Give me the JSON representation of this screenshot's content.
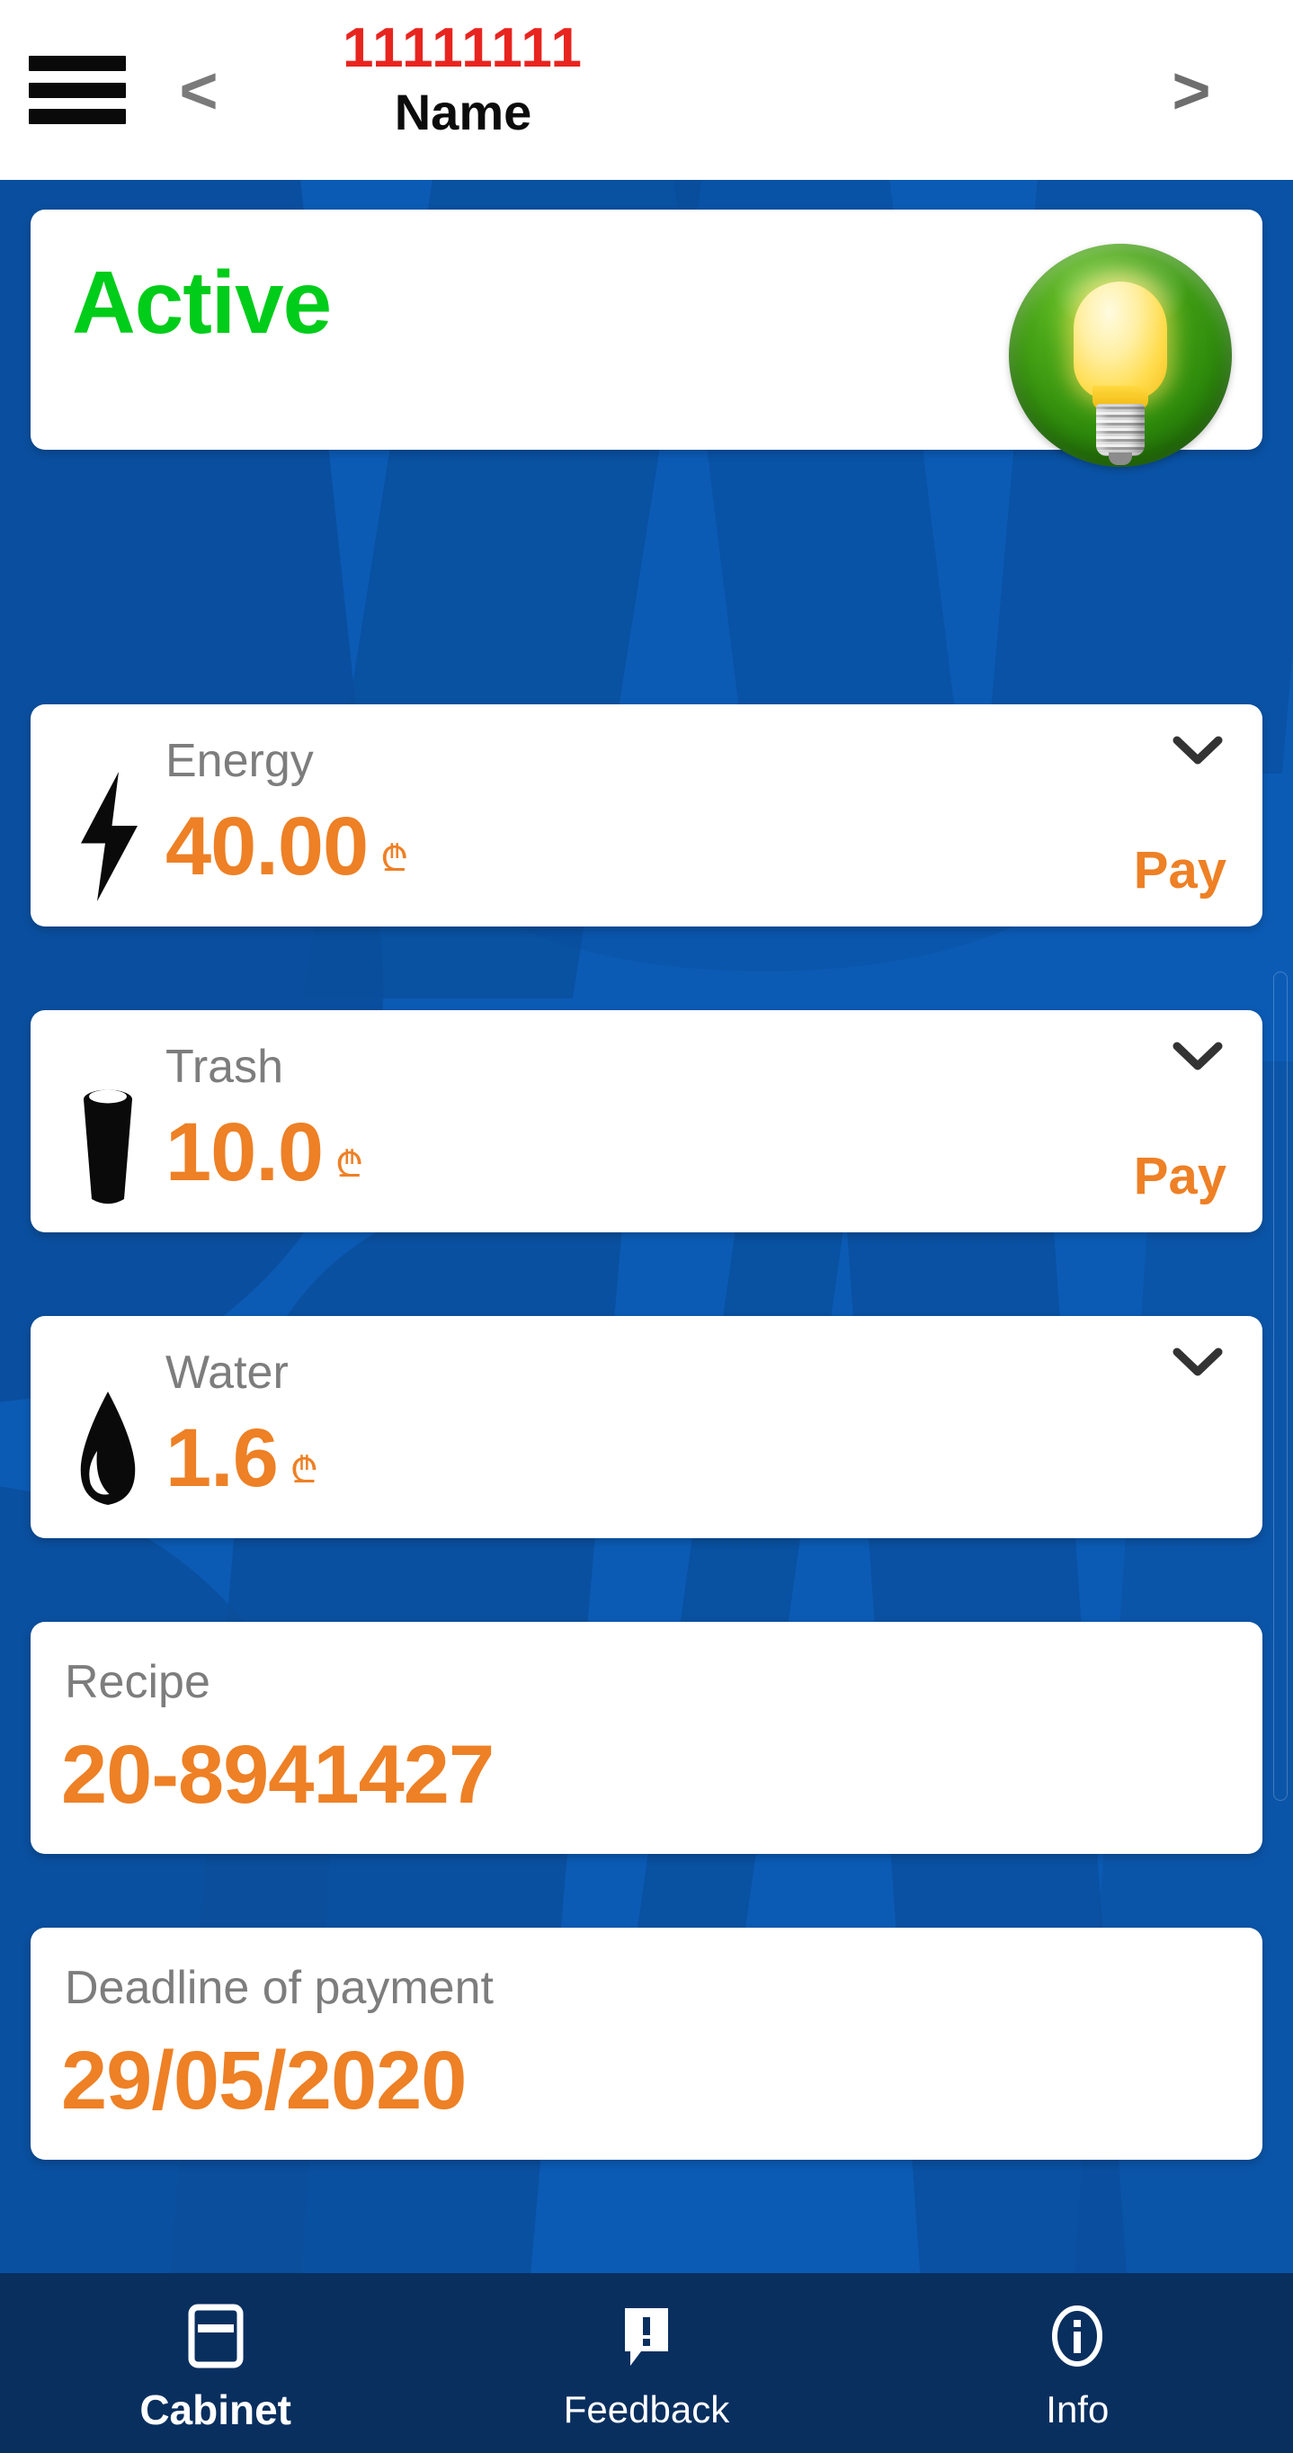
{
  "header": {
    "menu_icon": "hamburger-menu-icon",
    "prev_label": "<",
    "next_label": ">",
    "account_number": "11111111",
    "account_name": "Name",
    "number_color": "#E8241F"
  },
  "status_card": {
    "label": "Active",
    "color": "#00CC1A",
    "badge_icon": "lightbulb-icon",
    "badge_color": "#2E8B0C"
  },
  "currency_symbol": "₾",
  "accent_color": "#EE8025",
  "utilities": [
    {
      "name": "Energy",
      "icon": "lightning-bolt-icon",
      "amount": "40.00",
      "currency": "₾",
      "pay_label": "Pay",
      "has_pay": true,
      "expand_icon": "chevron-down-icon"
    },
    {
      "name": "Trash",
      "icon": "trash-bin-icon",
      "amount": "10.0",
      "currency": "₾",
      "pay_label": "Pay",
      "has_pay": true,
      "expand_icon": "chevron-down-icon"
    },
    {
      "name": "Water",
      "icon": "water-droplet-icon",
      "amount": "1.6",
      "currency": "₾",
      "pay_label": "",
      "has_pay": false,
      "expand_icon": "chevron-down-icon"
    }
  ],
  "info_cards": [
    {
      "label": "Recipe",
      "value": "20-8941427"
    },
    {
      "label": "Deadline of payment",
      "value": "29/05/2020"
    }
  ],
  "bottom_nav": {
    "items": [
      {
        "label": "Cabinet",
        "icon": "card-icon",
        "active": true
      },
      {
        "label": "Feedback",
        "icon": "speech-bubble-alert-icon",
        "active": false
      },
      {
        "label": "Info",
        "icon": "info-circle-icon",
        "active": false
      }
    ]
  },
  "background": {
    "color": "#0B5BB5",
    "accent_shape_color": "#0A4D9B"
  }
}
